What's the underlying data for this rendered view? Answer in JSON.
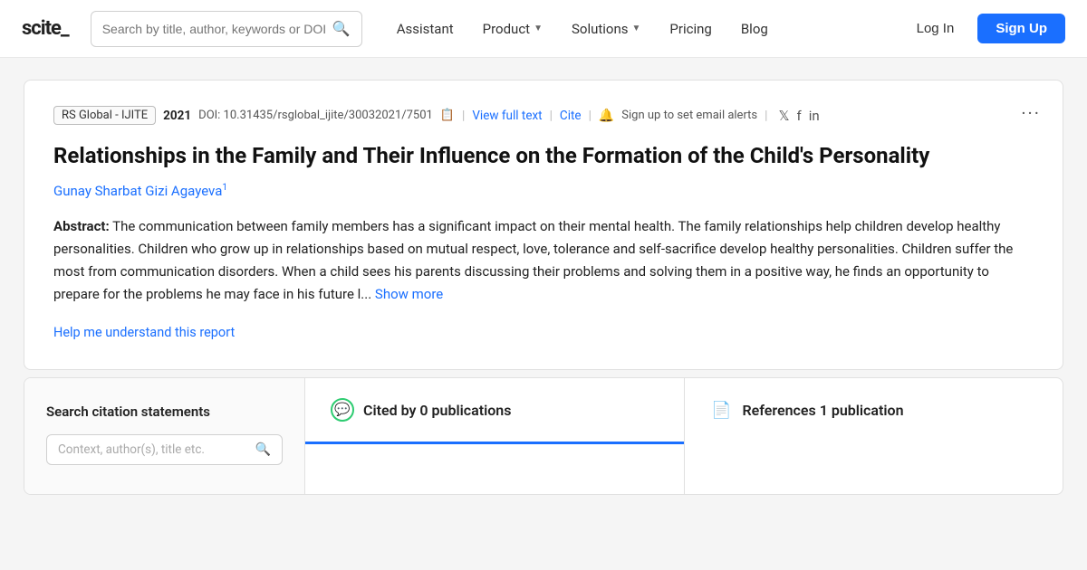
{
  "nav": {
    "logo": "scite_",
    "logo_accent": "scite",
    "logo_underscore": "_",
    "search_placeholder": "Search by title, author, keywords or DOI",
    "links": [
      {
        "label": "Assistant",
        "has_chevron": false
      },
      {
        "label": "Product",
        "has_chevron": true
      },
      {
        "label": "Solutions",
        "has_chevron": true
      },
      {
        "label": "Pricing",
        "has_chevron": false
      },
      {
        "label": "Blog",
        "has_chevron": false
      }
    ],
    "login_label": "Log In",
    "signup_label": "Sign Up"
  },
  "article": {
    "publisher": "RS Global - IJITE",
    "year": "2021",
    "doi": "DOI: 10.31435/rsglobal_ijite/30032021/7501",
    "view_full_text": "View full text",
    "cite_label": "Cite",
    "alert_text": "Sign up to set email alerts",
    "title": "Relationships in the Family and Their Influence on the Formation of the Child's Personality",
    "authors": "Gunay Sharbat Gizi Agayeva",
    "author_superscript": "1",
    "abstract_label": "Abstract:",
    "abstract_text": "The communication between family members has a significant impact on their mental health. The family relationships help children develop healthy personalities. Children who grow up in relationships based on mutual respect, love, tolerance and self-sacrifice develop healthy personalities. Children suffer the most from communication disorders. When a child sees his parents discussing their problems and solving them in a positive way, he finds an opportunity to prepare for the problems he may face in his future l...",
    "show_more": "Show more",
    "help_link": "Help me understand this report",
    "more_icon": "···"
  },
  "panels": {
    "search": {
      "title": "Search citation statements",
      "input_placeholder": "Context, author(s), title etc."
    },
    "cited": {
      "label": "Cited by 0 publications",
      "tab_active": true
    },
    "references": {
      "label": "References 1 publication",
      "tab_active": false
    }
  }
}
